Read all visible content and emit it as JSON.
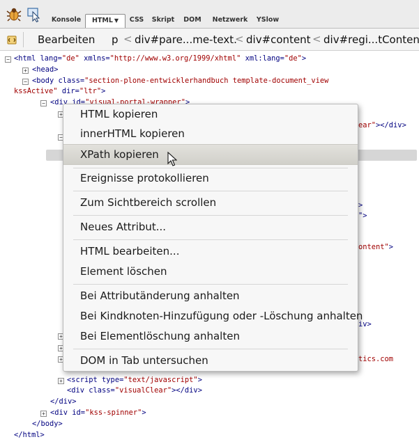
{
  "toolbar": {
    "tabs": [
      "Konsole",
      "HTML",
      "CSS",
      "Skript",
      "DOM",
      "Netzwerk",
      "YSlow"
    ],
    "active_tab": "HTML",
    "icons": [
      "firebug-icon",
      "inspect-icon"
    ]
  },
  "breadcrumb": {
    "edit_label": "Bearbeiten",
    "items": [
      "p",
      "div#pare...me-text.",
      "div#content",
      "div#regi...tContent"
    ]
  },
  "tree": {
    "l1a": "<html ",
    "l1b": "lang=",
    "l1c": "\"de\"",
    "l1d": " xmlns=",
    "l1e": "\"http://www.w3.org/1999/xhtml\"",
    "l1f": " xml:lang=",
    "l1g": "\"de\"",
    "l1h": ">",
    "l2": "<head>",
    "l3a": "<body ",
    "l3b": "class=",
    "l3c": "\"section-plone-entwicklerhandbuch template-document_view",
    "l4a": "kssActive\"",
    "l4b": " dir=",
    "l4c": "\"ltr\"",
    "l4d": ">",
    "l5a": "<div ",
    "l5b": "id=",
    "l5c": "\"visual-portal-wrapper\"",
    "l5d": ">",
    "frag1a": "ear\"",
    "frag1b": "></div>",
    "frag2": ">",
    "frag3": "\">",
    "frag4a": "ontent\"",
    "frag4b": ">",
    "frag5": "iv>",
    "frag6": "tics.com",
    "l6a": "<script ",
    "l6b": "type=",
    "l6c": "\"text/javascript\"",
    "l6d": ">",
    "l7a": "<div ",
    "l7b": "class=",
    "l7c": "\"visualClear\"",
    "l7d": "></div>",
    "l8": "</div>",
    "l9a": "<div ",
    "l9b": "id=",
    "l9c": "\"kss-spinner\"",
    "l9d": ">",
    "l10": "</body>",
    "l11": "</html>"
  },
  "context_menu": {
    "items": [
      "HTML kopieren",
      "innerHTML kopieren",
      "XPath kopieren",
      "Ereignisse protokollieren",
      "Zum Sichtbereich scrollen",
      "Neues Attribut...",
      "HTML bearbeiten...",
      "Element löschen",
      "Bei Attributänderung anhalten",
      "Bei Kindknoten-Hinzufügung oder -Löschung anhalten",
      "Bei Elementlöschung anhalten",
      "DOM in Tab untersuchen"
    ],
    "highlighted": "XPath kopieren"
  },
  "colors": {
    "tag": "#000080",
    "attr_value": "#a00000",
    "menu_highlight": "#d8d7d1"
  }
}
